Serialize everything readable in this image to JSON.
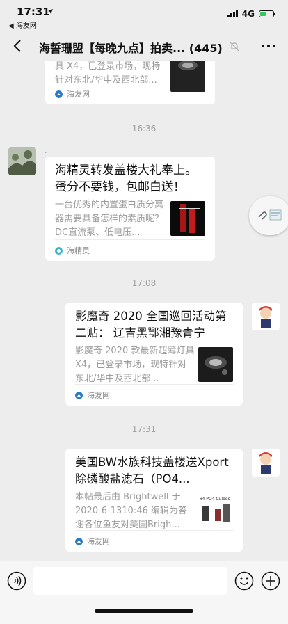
{
  "status": {
    "time": "17:31",
    "back_app": "◀ 海友网",
    "network": "4G"
  },
  "nav": {
    "title": "海誓珊盟【每晚九点】拍卖... (445)"
  },
  "messages": [
    {
      "desc_tail": "针对东北/华中及西北部...",
      "source": "海友网"
    },
    {
      "timestamp": "16:36"
    },
    {
      "sender": ".",
      "title": "海精灵转发盖楼大礼奉上。蛋分不要钱，包邮白送！",
      "desc": "一台优秀的内置蛋白质分离器需要具备怎样的素质呢？DC直流泵、低电压...",
      "source": "海精灵"
    },
    {
      "timestamp": "17:08"
    },
    {
      "title": "影魔奇 2020 全国巡回活动第二贴： 辽吉黑鄂湘豫青宁",
      "desc": "影魔奇 2020 款最新超薄灯具 X4，已登录市场，现特针对东北/华中及西北部...",
      "source": "海友网"
    },
    {
      "timestamp": "17:31"
    },
    {
      "title": "美国BW水族科技盖楼送Xport除磷酸盐滤石（PO4...",
      "desc": "本帖最后由 Brightwell 于 2020-6-1310:46 编辑为答谢各位鱼友对美国Brigh...",
      "source": "海友网"
    }
  ],
  "thumb_text": "x4 PO4 Culbes",
  "colors": {
    "background": "#ededed",
    "bubble": "#ffffff",
    "battery": "#34c759",
    "timestamp": "#a0a0a0"
  }
}
